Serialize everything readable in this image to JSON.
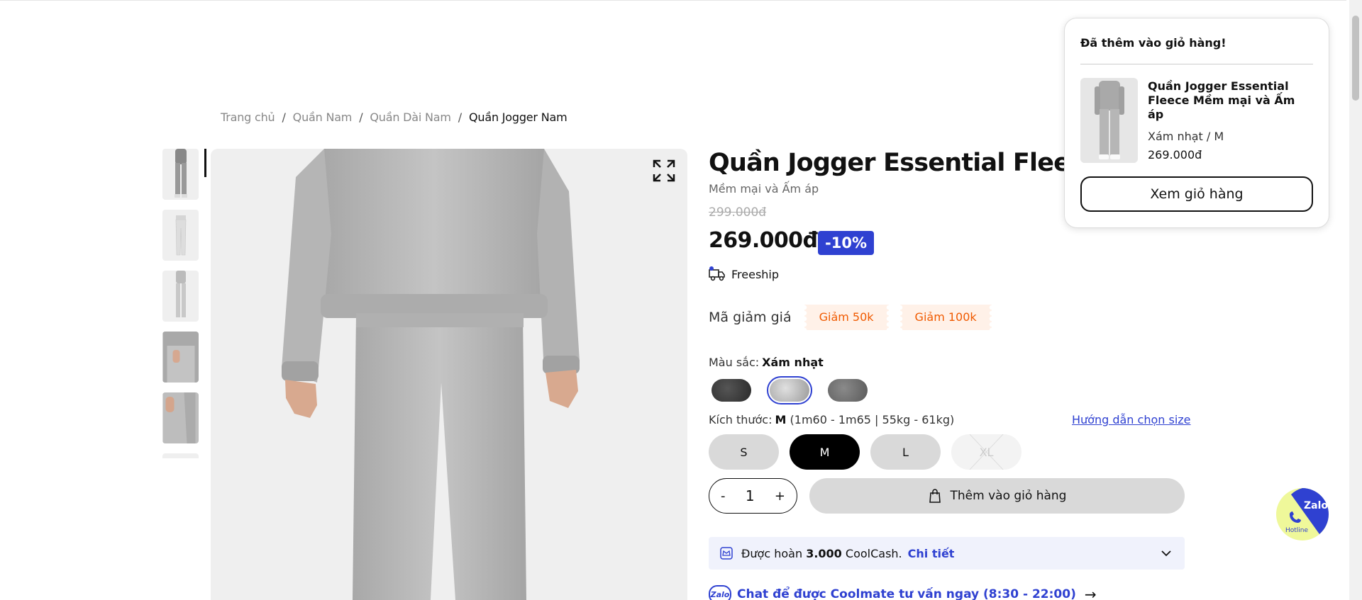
{
  "breadcrumb": {
    "items": [
      "Trang chủ",
      "Quần Nam",
      "Quần Dài Nam"
    ],
    "current": "Quần Jogger Nam",
    "separator": "/"
  },
  "product": {
    "title": "Quần Jogger Essential Fleece",
    "subtitle": "Mềm mại và Ấm áp",
    "old_price": "299.000đ",
    "price": "269.000đ",
    "discount": "-10%",
    "freeship": "Freeship",
    "coupon_label": "Mã giảm giá",
    "coupons": [
      "Giảm 50k",
      "Giảm 100k"
    ],
    "color_label": "Màu sắc:",
    "color_selected": "Xám nhạt",
    "colors": [
      "#3a3a3a",
      "#b9b9b9",
      "#6e6e6e"
    ],
    "size_label": "Kích thước:",
    "size_selected": "M",
    "size_fit": "(1m60 - 1m65 | 55kg - 61kg)",
    "size_guide": "Hướng dẫn chọn size",
    "sizes": [
      "S",
      "M",
      "L",
      "XL"
    ],
    "quantity": "1",
    "qty_minus": "-",
    "qty_plus": "+",
    "add_to_cart": "Thêm vào giỏ hàng",
    "coolcash_prefix": "Được hoàn",
    "coolcash_amount": "3.000",
    "coolcash_suffix": "CoolCash.",
    "coolcash_detail": "Chi tiết",
    "zalo_chat": "Chat để được Coolmate tư vấn ngay (8:30 - 22:00)",
    "zalo_badge": "Zalo",
    "arrow": "→"
  },
  "cart_popup": {
    "heading": "Đã thêm vào giỏ hàng!",
    "item_name": "Quần Jogger Essential Fleece Mềm mại và Ấm áp",
    "item_variant": "Xám nhạt / M",
    "item_price": "269.000đ",
    "view_cart": "Xem giỏ hàng"
  },
  "floating": {
    "zalo": "Zalo",
    "hotline": "Hotline"
  },
  "colors": {
    "accent": "#2f41d1",
    "coupon_text": "#f05a00",
    "coupon_bg": "#fff1e8"
  }
}
